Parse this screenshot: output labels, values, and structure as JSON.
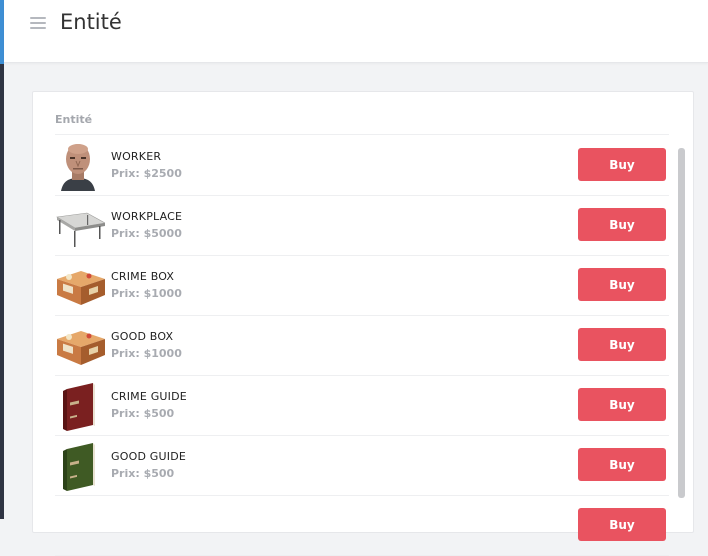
{
  "header": {
    "title": "Entité"
  },
  "panel": {
    "section_title": "Entité",
    "buy_label": "Buy"
  },
  "items": [
    {
      "name": "WORKER",
      "price": "Prix: $2500",
      "icon": "worker-avatar-icon"
    },
    {
      "name": "WORKPLACE",
      "price": "Prix: $5000",
      "icon": "workbench-icon"
    },
    {
      "name": "CRIME BOX",
      "price": "Prix: $1000",
      "icon": "crate-icon"
    },
    {
      "name": "GOOD BOX",
      "price": "Prix: $1000",
      "icon": "crate-icon"
    },
    {
      "name": "CRIME GUIDE",
      "price": "Prix: $500",
      "icon": "book-icon"
    },
    {
      "name": "GOOD GUIDE",
      "price": "Prix: $500",
      "icon": "book-icon"
    }
  ],
  "colors": {
    "accent": "#e95360",
    "sidebar_accent": "#3e8fd4",
    "crime_book": "#7a2020",
    "good_book": "#3f5a24"
  }
}
